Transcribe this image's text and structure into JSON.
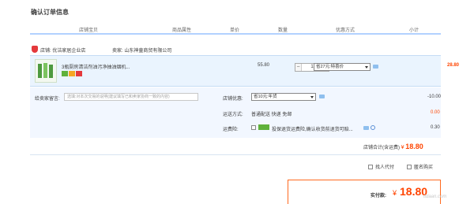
{
  "section_title": "确认订单信息",
  "columns": [
    "店铺宝贝",
    "商品属性",
    "单价",
    "数量",
    "优惠方式",
    "小计"
  ],
  "shop": {
    "store_label": "店铺: 优洁家居企业店",
    "seller_label": "卖家: 山东神童商贸有限公司"
  },
  "item": {
    "title": "3瓶厨房清洁剂油污净抽油烟机...",
    "price": "55.80",
    "quantity": "1",
    "discount_select": "省27元:特喜价",
    "subtotal": "28.80"
  },
  "options": {
    "message_label": "给卖家留言:",
    "message_placeholder": "选填:对本次交易的说明(建议填写已和卖家协商一致的内容)",
    "store_discount_label": "店铺优惠:",
    "store_discount_select": "省10元:年货",
    "store_discount_amount": "-10.00",
    "shipping_label": "运送方式:",
    "shipping_value": "普通配送 快递 免邮",
    "shipping_fee": "0.00",
    "insurance_label": "运费险:",
    "insurance_text": "投保退货运费险,确认收货前退货可赔...",
    "insurance_fee": "0.30"
  },
  "total": {
    "label": "店铺合计(含运费)",
    "currency": "¥",
    "amount": "18.80"
  },
  "aux_options": {
    "pay_for_me": "找人代付",
    "anonymous": "匿名购买"
  },
  "payment": {
    "label": "实付款:",
    "currency": "¥",
    "amount": "18.80"
  },
  "watermark": "itdaan.com",
  "colors": {
    "accent_orange": "#ff4400",
    "header_line": "#b2d1ff",
    "item_bg": "#eaf4fe",
    "options_bg": "#f2f7ff"
  }
}
